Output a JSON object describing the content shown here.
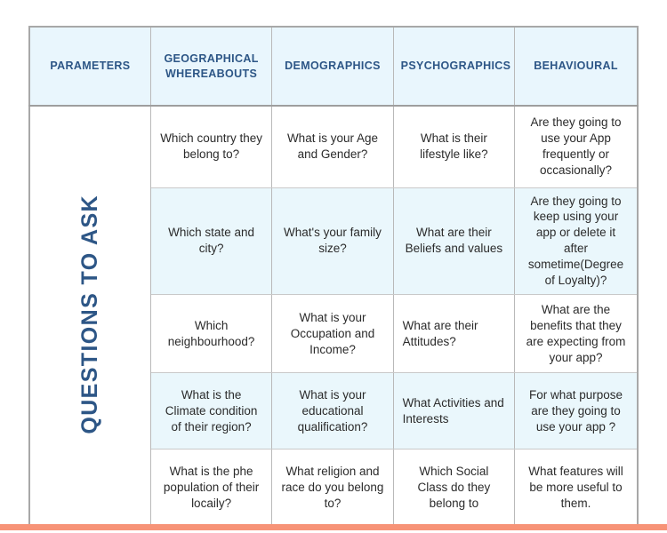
{
  "table": {
    "row_label": "QUESTIONS TO ASK",
    "headers": [
      "PARAMETERS",
      "GEOGRAPHICAL WHEREABOUTS",
      "DEMOGRAPHICS",
      "PSYCHOGRAPHICS",
      "BEHAVIOURAL"
    ],
    "rows": [
      {
        "geographical": "Which country they belong to?",
        "demographics": "What is your Age and Gender?",
        "psychographics": "What is their lifestyle like?",
        "behavioural": "Are they going to use your App frequently or occasionally?"
      },
      {
        "geographical": "Which state and city?",
        "demographics": "What's your family size?",
        "psychographics": "What are their Beliefs and values",
        "behavioural": "Are they going to keep using your app or delete it after sometime(Degree of Loyalty)?"
      },
      {
        "geographical": "Which neighbourhood?",
        "demographics": "What is your Occupation and Income?",
        "psychographics": "What are their Attitudes?",
        "behavioural": "What are the benefits that they are expecting from your app?"
      },
      {
        "geographical": "What is the Climate condition of their region?",
        "demographics": "What is your educational qualification?",
        "psychographics": "What Activities and Interests",
        "behavioural": "For what purpose are they going to use your app ?"
      },
      {
        "geographical": "What is the phe population of their locaily?",
        "demographics": "What religion and race do you belong to?",
        "psychographics": "Which Social Class do they belong to",
        "behavioural": "What features will be more useful to them."
      }
    ]
  },
  "colors": {
    "header_background": "#e9f6fd",
    "header_text": "#2d5686",
    "shaded_row_background": "#eaf7fc",
    "accent_bar": "#f79377",
    "grid_line": "#b9b9b9",
    "outer_border": "#a8a8a8",
    "body_text": "#2b2b2b"
  }
}
